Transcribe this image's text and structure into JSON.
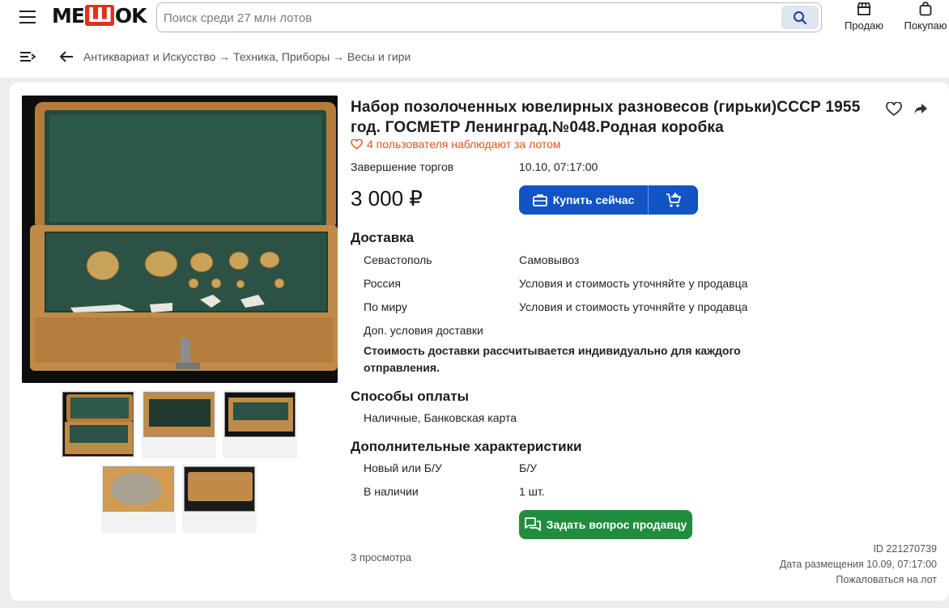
{
  "header": {
    "logo_left": "ME",
    "logo_mid": "Ш",
    "logo_right": "OK",
    "search_placeholder": "Поиск среди 27 млн лотов",
    "sell_label": "Продаю",
    "buy_label": "Покупаю"
  },
  "breadcrumb": {
    "path": "Антиквариат и Искусство → Техника, Приборы → Весы и гири"
  },
  "lot": {
    "title": "Набор позолоченных ювелирных разновесов (гирьки)СССР 1955 год. ГОСМЕТР Ленинград.№048.Родная коробка",
    "watchers": "4 пользователя наблюдают за лотом",
    "end_label": "Завершение торгов",
    "end_value": "10.10, 07:17:00",
    "price": "3 000 ₽",
    "buy_now": "Купить сейчас",
    "delivery_title": "Доставка",
    "delivery": [
      {
        "place": "Севастополь",
        "terms": "Самовывоз"
      },
      {
        "place": "Россия",
        "terms": "Условия и стоимость уточняйте у продавца"
      },
      {
        "place": "По миру",
        "terms": "Условия и стоимость уточняйте у продавца"
      }
    ],
    "extra_delivery_label": "Доп. условия доставки",
    "extra_delivery_line1": "Стоимость доставки рассчитывается индивидуально для каждого",
    "extra_delivery_line2": "отправления.",
    "payment_title": "Способы оплаты",
    "payment_methods": "Наличные, Банковская карта",
    "chars_title": "Дополнительные характеристики",
    "chars": [
      {
        "name": "Новый или Б/У",
        "value": "Б/У"
      },
      {
        "name": "В наличии",
        "value": "1 шт."
      }
    ],
    "ask_seller": "Задать вопрос продавцу",
    "views": "3 просмотра",
    "id": "ID 221270739",
    "posted": "Дата размещения 10.09, 07:17:00",
    "report": "Пожаловаться на лот"
  },
  "colors": {
    "primary_blue": "#1254c4",
    "green": "#1f8d3d",
    "watch_orange": "#e8501e",
    "logo_red": "#e3301c"
  }
}
